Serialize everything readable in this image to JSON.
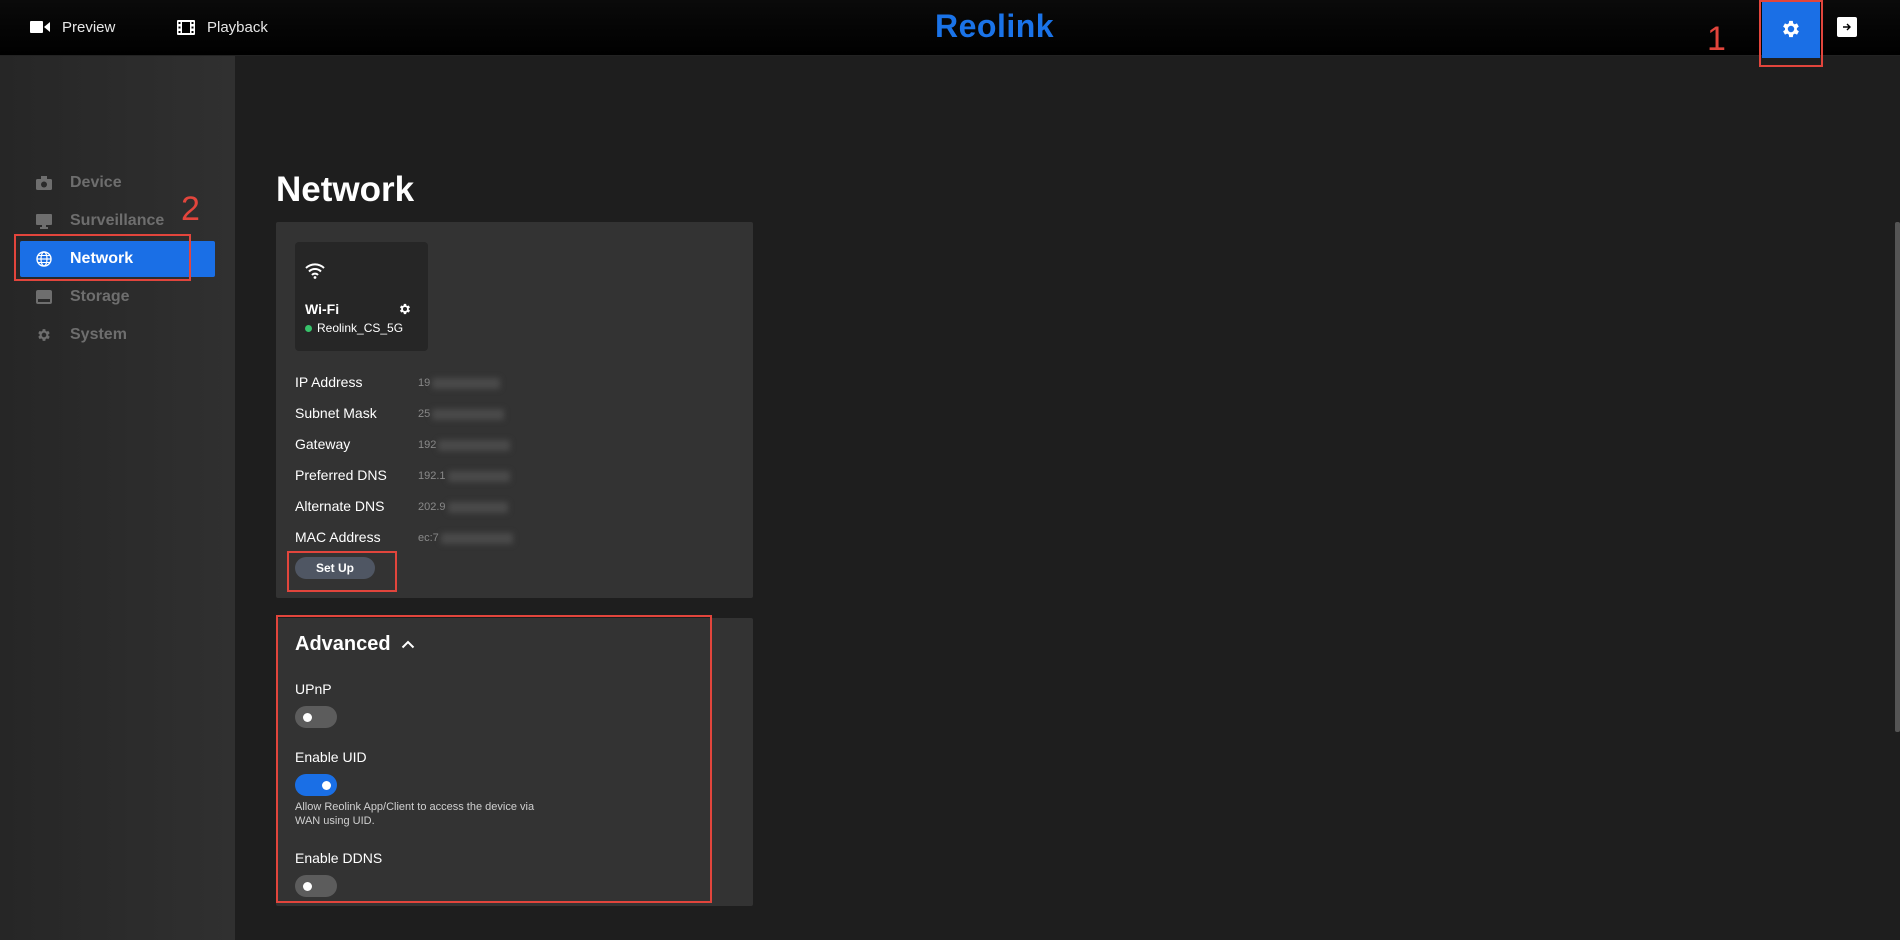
{
  "topbar": {
    "preview_label": "Preview",
    "playback_label": "Playback",
    "logo_text": "Reolink"
  },
  "annotations": [
    "1",
    "2"
  ],
  "sidebar": {
    "items": [
      {
        "label": "Device",
        "icon": "camera-icon"
      },
      {
        "label": "Surveillance",
        "icon": "monitor-icon"
      },
      {
        "label": "Network",
        "icon": "globe-icon",
        "active": true
      },
      {
        "label": "Storage",
        "icon": "storage-icon"
      },
      {
        "label": "System",
        "icon": "gear-icon"
      }
    ]
  },
  "main": {
    "title": "Network",
    "wifi": {
      "name": "Wi-Fi",
      "ssid": "Reolink_CS_5G",
      "status_color": "#37c26a"
    },
    "info": [
      {
        "label": "IP Address",
        "value": "19"
      },
      {
        "label": "Subnet Mask",
        "value": "25"
      },
      {
        "label": "Gateway",
        "value": "192"
      },
      {
        "label": "Preferred DNS",
        "value": "192.1"
      },
      {
        "label": "Alternate DNS",
        "value": "202.9"
      },
      {
        "label": "MAC Address",
        "value": "ec:7"
      }
    ],
    "setup_label": "Set Up",
    "advanced": {
      "title": "Advanced",
      "upnp_label": "UPnP",
      "upnp_on": false,
      "uid_label": "Enable UID",
      "uid_on": true,
      "uid_hint": "Allow Reolink App/Client to access the device via WAN using UID.",
      "ddns_label": "Enable DDNS",
      "ddns_on": false
    }
  },
  "colors": {
    "accent": "#1a6fe6",
    "annotation": "#e2453c"
  }
}
